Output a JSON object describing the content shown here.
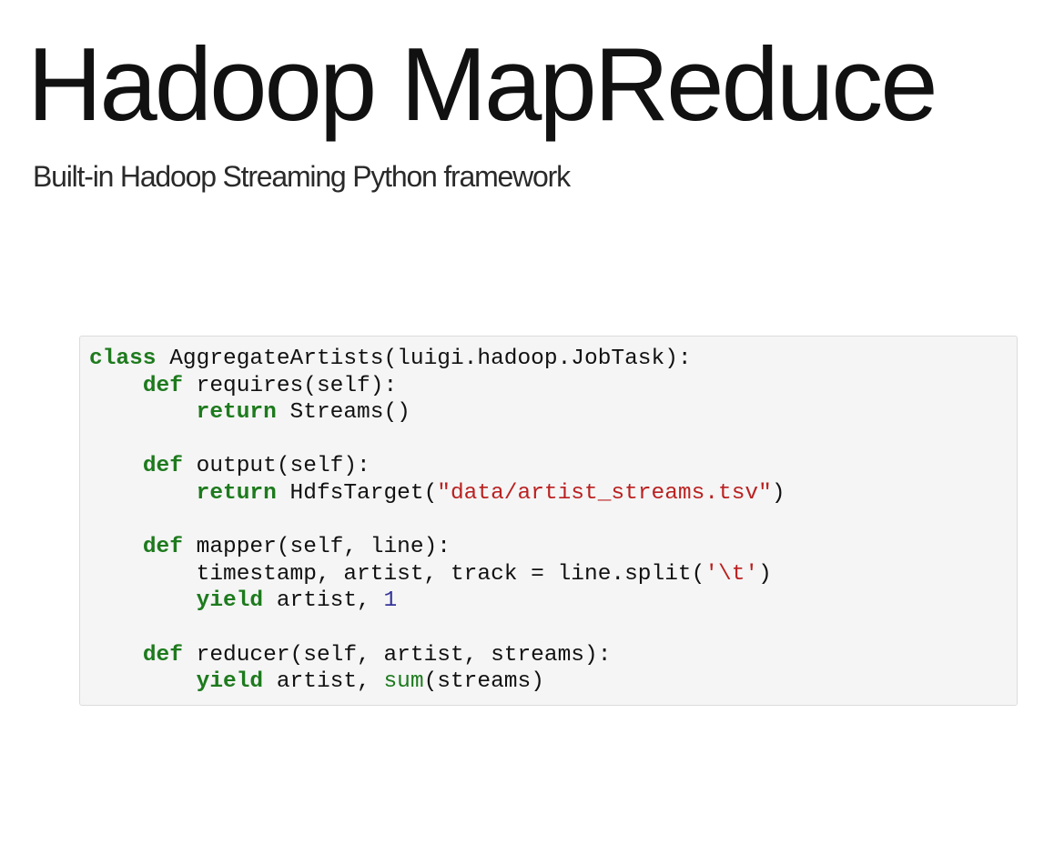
{
  "slide": {
    "title": "Hadoop MapReduce",
    "subtitle": "Built-in Hadoop Streaming Python framework"
  },
  "code": {
    "language": "python",
    "lines": [
      [
        {
          "t": "kw",
          "v": "class"
        },
        {
          "t": "plain",
          "v": " AggregateArtists(luigi.hadoop.JobTask):"
        }
      ],
      [
        {
          "t": "plain",
          "v": "    "
        },
        {
          "t": "kw",
          "v": "def"
        },
        {
          "t": "plain",
          "v": " requires(self):"
        }
      ],
      [
        {
          "t": "plain",
          "v": "        "
        },
        {
          "t": "kw",
          "v": "return"
        },
        {
          "t": "plain",
          "v": " Streams()"
        }
      ],
      [],
      [
        {
          "t": "plain",
          "v": "    "
        },
        {
          "t": "kw",
          "v": "def"
        },
        {
          "t": "plain",
          "v": " output(self):"
        }
      ],
      [
        {
          "t": "plain",
          "v": "        "
        },
        {
          "t": "kw",
          "v": "return"
        },
        {
          "t": "plain",
          "v": " HdfsTarget("
        },
        {
          "t": "str",
          "v": "\"data/artist_streams.tsv\""
        },
        {
          "t": "plain",
          "v": ")"
        }
      ],
      [],
      [
        {
          "t": "plain",
          "v": "    "
        },
        {
          "t": "kw",
          "v": "def"
        },
        {
          "t": "plain",
          "v": " mapper(self, line):"
        }
      ],
      [
        {
          "t": "plain",
          "v": "        timestamp, artist, track = line.split("
        },
        {
          "t": "str",
          "v": "'\\t'"
        },
        {
          "t": "plain",
          "v": ")"
        }
      ],
      [
        {
          "t": "plain",
          "v": "        "
        },
        {
          "t": "kw",
          "v": "yield"
        },
        {
          "t": "plain",
          "v": " artist, "
        },
        {
          "t": "num",
          "v": "1"
        }
      ],
      [],
      [
        {
          "t": "plain",
          "v": "    "
        },
        {
          "t": "kw",
          "v": "def"
        },
        {
          "t": "plain",
          "v": " reducer(self, artist, streams):"
        }
      ],
      [
        {
          "t": "plain",
          "v": "        "
        },
        {
          "t": "kw",
          "v": "yield"
        },
        {
          "t": "plain",
          "v": " artist, "
        },
        {
          "t": "builtin",
          "v": "sum"
        },
        {
          "t": "plain",
          "v": "(streams)"
        }
      ]
    ]
  },
  "colors": {
    "keyword": "#1d7a1d",
    "string": "#ba2121",
    "number": "#333399",
    "code_background": "#f5f5f5"
  }
}
